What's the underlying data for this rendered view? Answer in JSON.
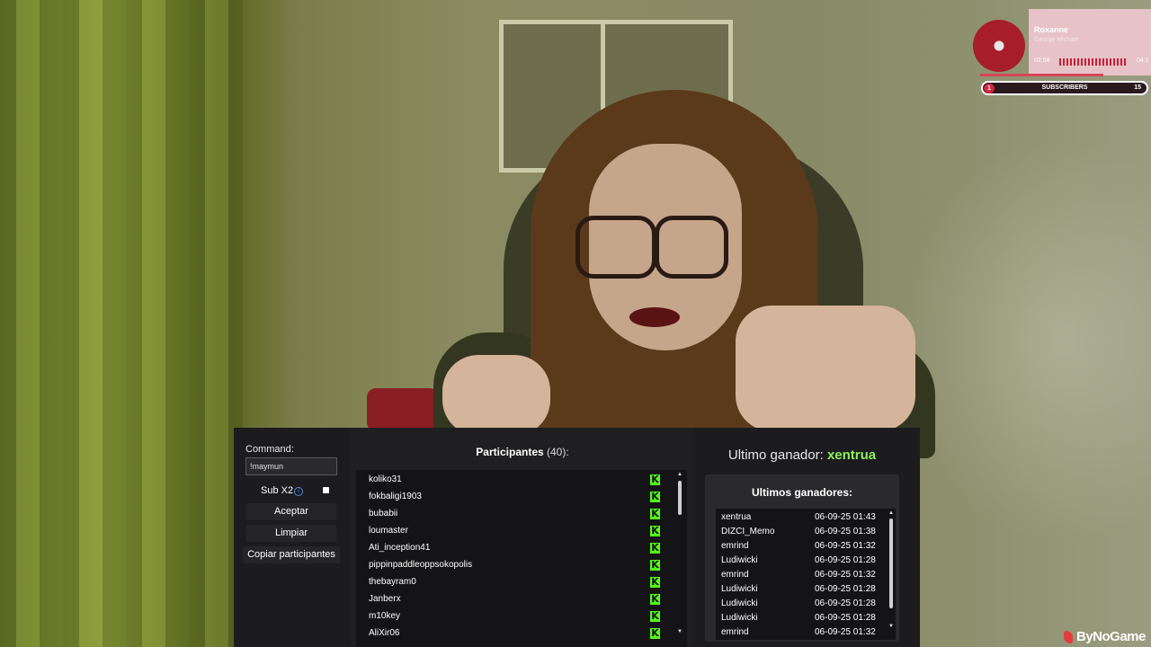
{
  "now_playing": {
    "title": "Roxanne",
    "artist": "George Michael",
    "elapsed": "02:58",
    "total": "04:1",
    "progress": 0.72,
    "accent": "#d22640"
  },
  "subscribers": {
    "label": "SUBSCRIBERS",
    "current": "1",
    "goal": "15"
  },
  "controls": {
    "command_label": "Command:",
    "command_value": "!maymun",
    "sub_label": "Sub X2",
    "sub_info_icon": "info-icon",
    "accept_label": "Aceptar",
    "clear_label": "Limpiar",
    "copy_label": "Copiar participantes"
  },
  "participants": {
    "title": "Participantes",
    "count": "(40):",
    "platform_icon": "kick-icon",
    "platform_color": "#53fc18",
    "items": [
      "koliko31",
      "fokbaligi1903",
      "bubabii",
      "loumaster",
      "Ati_inception41",
      "pippinpaddleoppsokopolis",
      "thebayram0",
      "Janberx",
      "m10key",
      "AliXir06"
    ]
  },
  "last_winner": {
    "label": "Ultimo ganador:",
    "name": "xentrua",
    "name_color": "#8ef15c"
  },
  "winners": {
    "title": "Ultimos ganadores:",
    "rows": [
      {
        "name": "xentrua",
        "date": "06-09-25 01:43"
      },
      {
        "name": "DIZCI_Memo",
        "date": "06-09-25 01:38"
      },
      {
        "name": "emrind",
        "date": "06-09-25 01:32"
      },
      {
        "name": "Ludiwicki",
        "date": "06-09-25 01:28"
      },
      {
        "name": "emrind",
        "date": "06-09-25 01:32"
      },
      {
        "name": "Ludiwicki",
        "date": "06-09-25 01:28"
      },
      {
        "name": "Ludiwicki",
        "date": "06-09-25 01:28"
      },
      {
        "name": "Ludiwicki",
        "date": "06-09-25 01:28"
      },
      {
        "name": "emrind",
        "date": "06-09-25 01:32"
      }
    ]
  },
  "watermark": "ByNoGame"
}
